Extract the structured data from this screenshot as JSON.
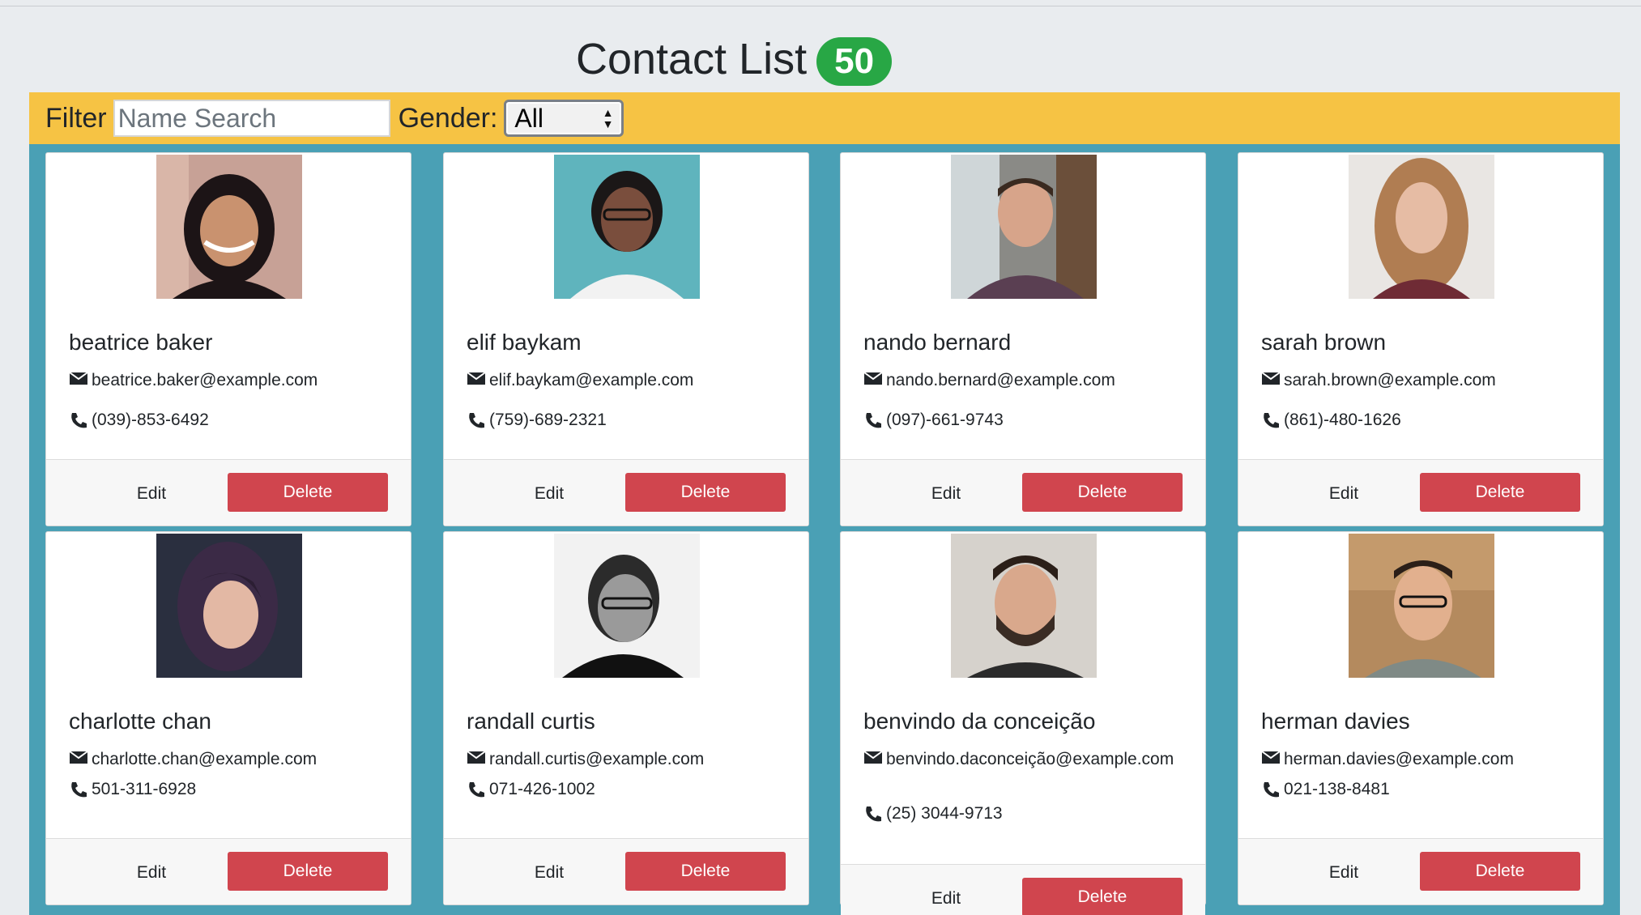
{
  "header": {
    "title": "Contact List",
    "count": "50"
  },
  "filter": {
    "label": "Filter",
    "search_placeholder": "Name Search",
    "gender_label": "Gender:",
    "gender_value": "All"
  },
  "buttons": {
    "edit": "Edit",
    "delete": "Delete"
  },
  "colors": {
    "filter_bar": "#f6c344",
    "grid_bg": "#4aa0b5",
    "badge": "#28a745",
    "delete": "#d0454e"
  },
  "contacts": [
    {
      "name": "beatrice baker",
      "email": "beatrice.baker@example.com",
      "phone": "(039)-853-6492"
    },
    {
      "name": "elif baykam",
      "email": "elif.baykam@example.com",
      "phone": "(759)-689-2321"
    },
    {
      "name": "nando bernard",
      "email": "nando.bernard@example.com",
      "phone": "(097)-661-9743"
    },
    {
      "name": "sarah brown",
      "email": "sarah.brown@example.com",
      "phone": "(861)-480-1626"
    },
    {
      "name": "charlotte chan",
      "email": "charlotte.chan@example.com",
      "phone": "501-311-6928"
    },
    {
      "name": "randall curtis",
      "email": "randall.curtis@example.com",
      "phone": "071-426-1002"
    },
    {
      "name": "benvindo da conceição",
      "email": "benvindo.daconceição@example.com",
      "phone": "(25) 3044-9713"
    },
    {
      "name": "herman davies",
      "email": "herman.davies@example.com",
      "phone": "021-138-8481"
    }
  ]
}
